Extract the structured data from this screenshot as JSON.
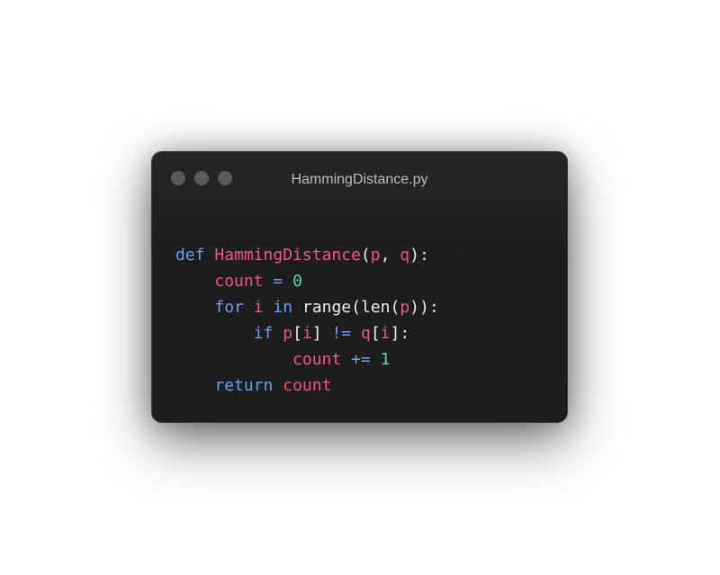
{
  "window": {
    "title": "HammingDistance.py",
    "controls": [
      "close",
      "minimize",
      "zoom"
    ]
  },
  "code": {
    "language": "python",
    "lines": [
      [
        {
          "t": "def",
          "c": "kw"
        },
        {
          "t": " ",
          "c": "pl"
        },
        {
          "t": "HammingDistance",
          "c": "id"
        },
        {
          "t": "(",
          "c": "pl"
        },
        {
          "t": "p",
          "c": "id"
        },
        {
          "t": ", ",
          "c": "pl"
        },
        {
          "t": "q",
          "c": "id"
        },
        {
          "t": "):",
          "c": "pl"
        }
      ],
      [
        {
          "t": "    ",
          "c": "pl"
        },
        {
          "t": "count",
          "c": "id"
        },
        {
          "t": " ",
          "c": "pl"
        },
        {
          "t": "=",
          "c": "kw"
        },
        {
          "t": " ",
          "c": "pl"
        },
        {
          "t": "0",
          "c": "num"
        }
      ],
      [
        {
          "t": "    ",
          "c": "pl"
        },
        {
          "t": "for",
          "c": "kw"
        },
        {
          "t": " ",
          "c": "pl"
        },
        {
          "t": "i",
          "c": "id"
        },
        {
          "t": " ",
          "c": "pl"
        },
        {
          "t": "in",
          "c": "kw"
        },
        {
          "t": " range(len(",
          "c": "pl"
        },
        {
          "t": "p",
          "c": "id"
        },
        {
          "t": ")):",
          "c": "pl"
        }
      ],
      [
        {
          "t": "        ",
          "c": "pl"
        },
        {
          "t": "if",
          "c": "kw"
        },
        {
          "t": " ",
          "c": "pl"
        },
        {
          "t": "p",
          "c": "id"
        },
        {
          "t": "[",
          "c": "pl"
        },
        {
          "t": "i",
          "c": "id"
        },
        {
          "t": "] ",
          "c": "pl"
        },
        {
          "t": "!=",
          "c": "kw"
        },
        {
          "t": " ",
          "c": "pl"
        },
        {
          "t": "q",
          "c": "id"
        },
        {
          "t": "[",
          "c": "pl"
        },
        {
          "t": "i",
          "c": "id"
        },
        {
          "t": "]:",
          "c": "pl"
        }
      ],
      [
        {
          "t": "            ",
          "c": "pl"
        },
        {
          "t": "count",
          "c": "id"
        },
        {
          "t": " ",
          "c": "pl"
        },
        {
          "t": "+=",
          "c": "kw"
        },
        {
          "t": " ",
          "c": "pl"
        },
        {
          "t": "1",
          "c": "num"
        }
      ],
      [
        {
          "t": "    ",
          "c": "pl"
        },
        {
          "t": "return",
          "c": "kw"
        },
        {
          "t": " ",
          "c": "pl"
        },
        {
          "t": "count",
          "c": "id"
        }
      ]
    ]
  },
  "colors": {
    "keyword": "#6aa0f2",
    "identifier": "#f2548a",
    "number": "#4fe0a5",
    "plain": "#ededed",
    "background": "#1e1e1f"
  }
}
